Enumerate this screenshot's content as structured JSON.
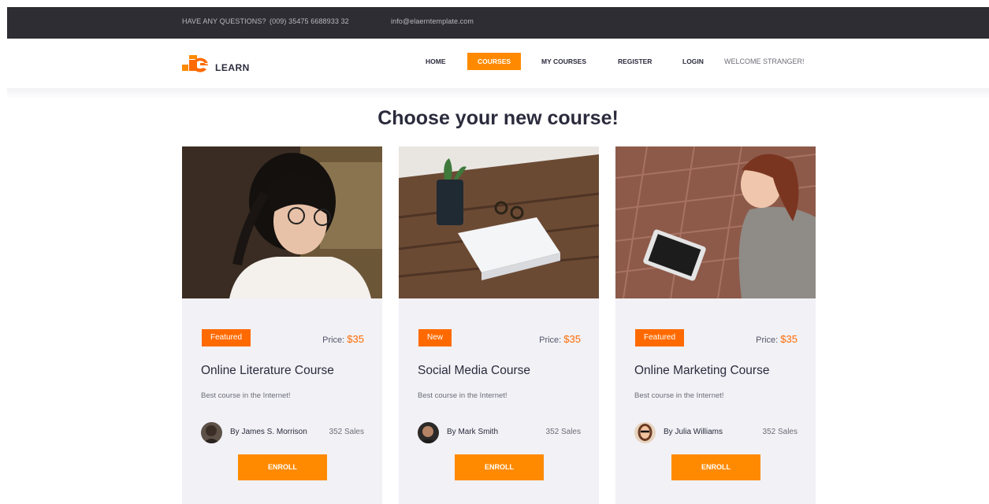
{
  "topbar": {
    "question": "HAVE ANY QUESTIONS?",
    "phone": "(009) 35475 6688933 32",
    "email": "info@elaerntemplate.com"
  },
  "logo": {
    "text": "LEARN"
  },
  "nav": {
    "items": [
      {
        "label": "HOME"
      },
      {
        "label": "COURSES",
        "active": true
      },
      {
        "label": "MY COURSES"
      },
      {
        "label": "REGISTER"
      },
      {
        "label": "LOGIN"
      }
    ],
    "welcome": "WELCOME STRANGER!"
  },
  "colors": {
    "accent": "#ff8a00",
    "badge": "#ff6a00",
    "dark": "#2e2d33",
    "title": "#2b2b3d"
  },
  "heading": "Choose your new course!",
  "courses": [
    {
      "badge": "Featured",
      "price_label": "Price:",
      "price": "$35",
      "title": "Online Literature Course",
      "subtitle": "Best course in the Internet!",
      "author": "By James S. Morrison",
      "sales": "352 Sales",
      "enroll": "ENROLL"
    },
    {
      "badge": "New",
      "price_label": "Price:",
      "price": "$35",
      "title": "Social Media Course",
      "subtitle": "Best course in the Internet!",
      "author": "By Mark Smith",
      "sales": "352 Sales",
      "enroll": "ENROLL"
    },
    {
      "badge": "Featured",
      "price_label": "Price:",
      "price": "$35",
      "title": "Online Marketing Course",
      "subtitle": "Best course in the Internet!",
      "author": "By Julia Williams",
      "sales": "352 Sales",
      "enroll": "ENROLL"
    }
  ]
}
